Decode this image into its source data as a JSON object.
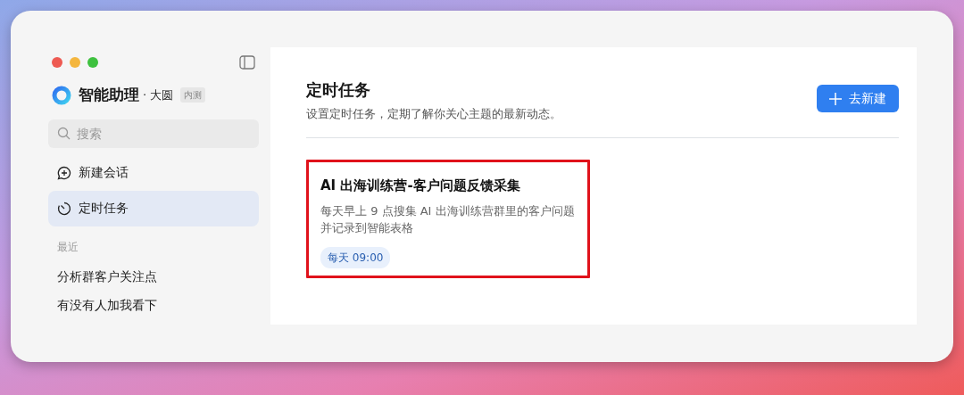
{
  "sidebar": {
    "app_name": "智能助理",
    "workspace": "· 大圆",
    "badge": "内测",
    "search": {
      "placeholder": "搜索"
    },
    "items": [
      {
        "kind": "chat",
        "label": "新建会话",
        "selected": false
      },
      {
        "kind": "clock",
        "label": "定时任务",
        "selected": true
      }
    ],
    "recent_heading": "最近",
    "recent": [
      "分析群客户关注点",
      "有没有人加我看下"
    ]
  },
  "main": {
    "title": "定时任务",
    "subtitle": "设置定时任务，定期了解你关心主题的最新动态。",
    "new_button": "去新建",
    "tasks": [
      {
        "title": "AI 出海训练营-客户问题反馈采集",
        "description": "每天早上 9 点搜集 AI 出海训练营群里的客户问题并记录到智能表格",
        "schedule": "每天 09:00",
        "highlighted": true
      }
    ]
  }
}
